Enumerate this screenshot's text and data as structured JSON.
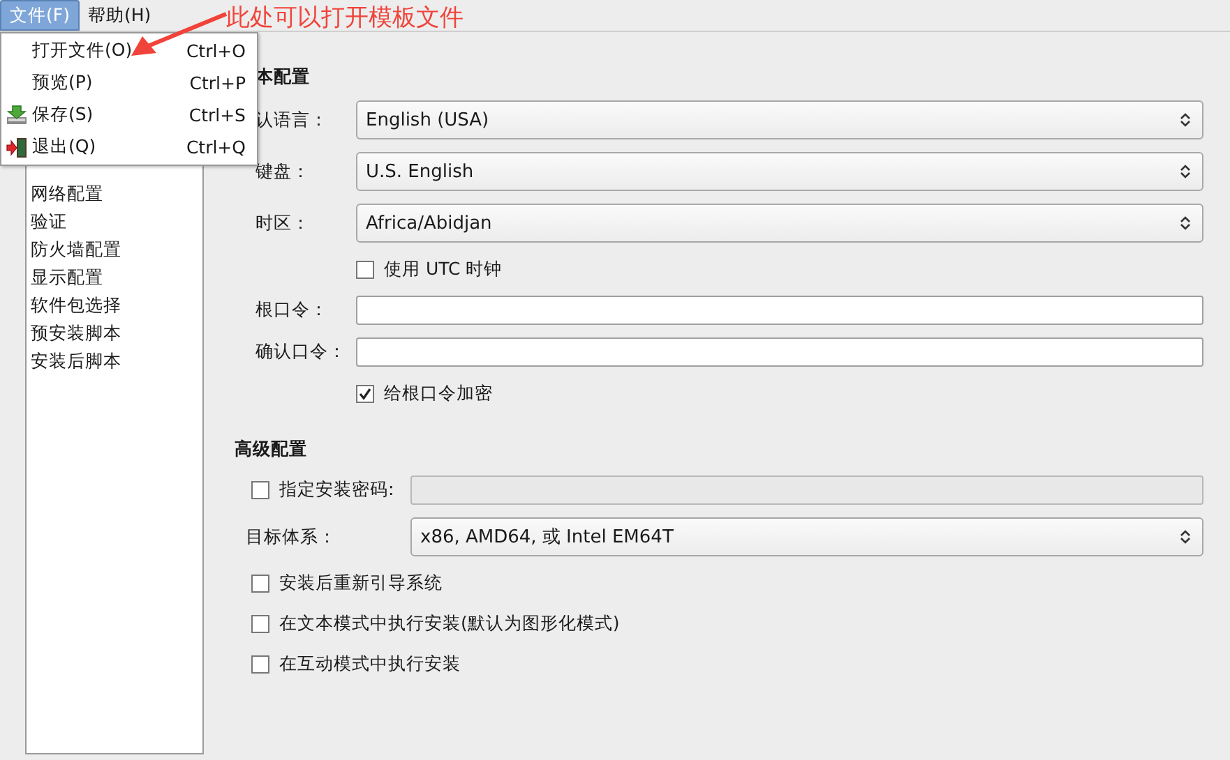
{
  "menubar": [
    {
      "label": "文件(F)",
      "selected": true
    },
    {
      "label": "帮助(H)",
      "selected": false
    }
  ],
  "file_menu": [
    {
      "label": "打开文件(O)",
      "shortcut": "Ctrl+O",
      "kind": "plain"
    },
    {
      "label": "预览(P)",
      "shortcut": "Ctrl+P",
      "kind": "plain"
    },
    {
      "label": "保存(S)",
      "shortcut": "Ctrl+S",
      "kind": "save"
    },
    {
      "label": "退出(Q)",
      "shortcut": "Ctrl+Q",
      "kind": "exit"
    }
  ],
  "annotation": "此处可以打开模板文件",
  "sidebar": [
    "网络配置",
    "验证",
    "防火墙配置",
    "显示配置",
    "软件包选择",
    "预安装脚本",
    "安装后脚本"
  ],
  "basic": {
    "heading": "本配置",
    "rows": [
      {
        "kind": "select",
        "label": "认语言：",
        "value": "English (USA)"
      },
      {
        "kind": "select",
        "label": "键盘：",
        "value": "U.S. English"
      },
      {
        "kind": "select",
        "label": "时区：",
        "value": "Africa/Abidjan"
      },
      {
        "kind": "checkbox",
        "label": "使用 UTC 时钟",
        "checked": false
      },
      {
        "kind": "input",
        "label": "根口令："
      },
      {
        "kind": "input",
        "label": "确认口令："
      },
      {
        "kind": "checkbox",
        "label": "给根口令加密",
        "checked": true
      }
    ]
  },
  "advanced": {
    "heading": "高级配置",
    "rows": [
      {
        "kind": "checkbox_input",
        "label": "指定安装密码:",
        "checked": false
      },
      {
        "kind": "select",
        "label": "目标体系：",
        "value": "x86, AMD64, 或 Intel EM64T"
      },
      {
        "kind": "checkbox",
        "label": "安装后重新引导系统",
        "checked": false
      },
      {
        "kind": "checkbox",
        "label": "在文本模式中执行安装(默认为图形化模式)",
        "checked": false
      },
      {
        "kind": "checkbox",
        "label": "在互动模式中执行安装",
        "checked": false
      }
    ]
  }
}
